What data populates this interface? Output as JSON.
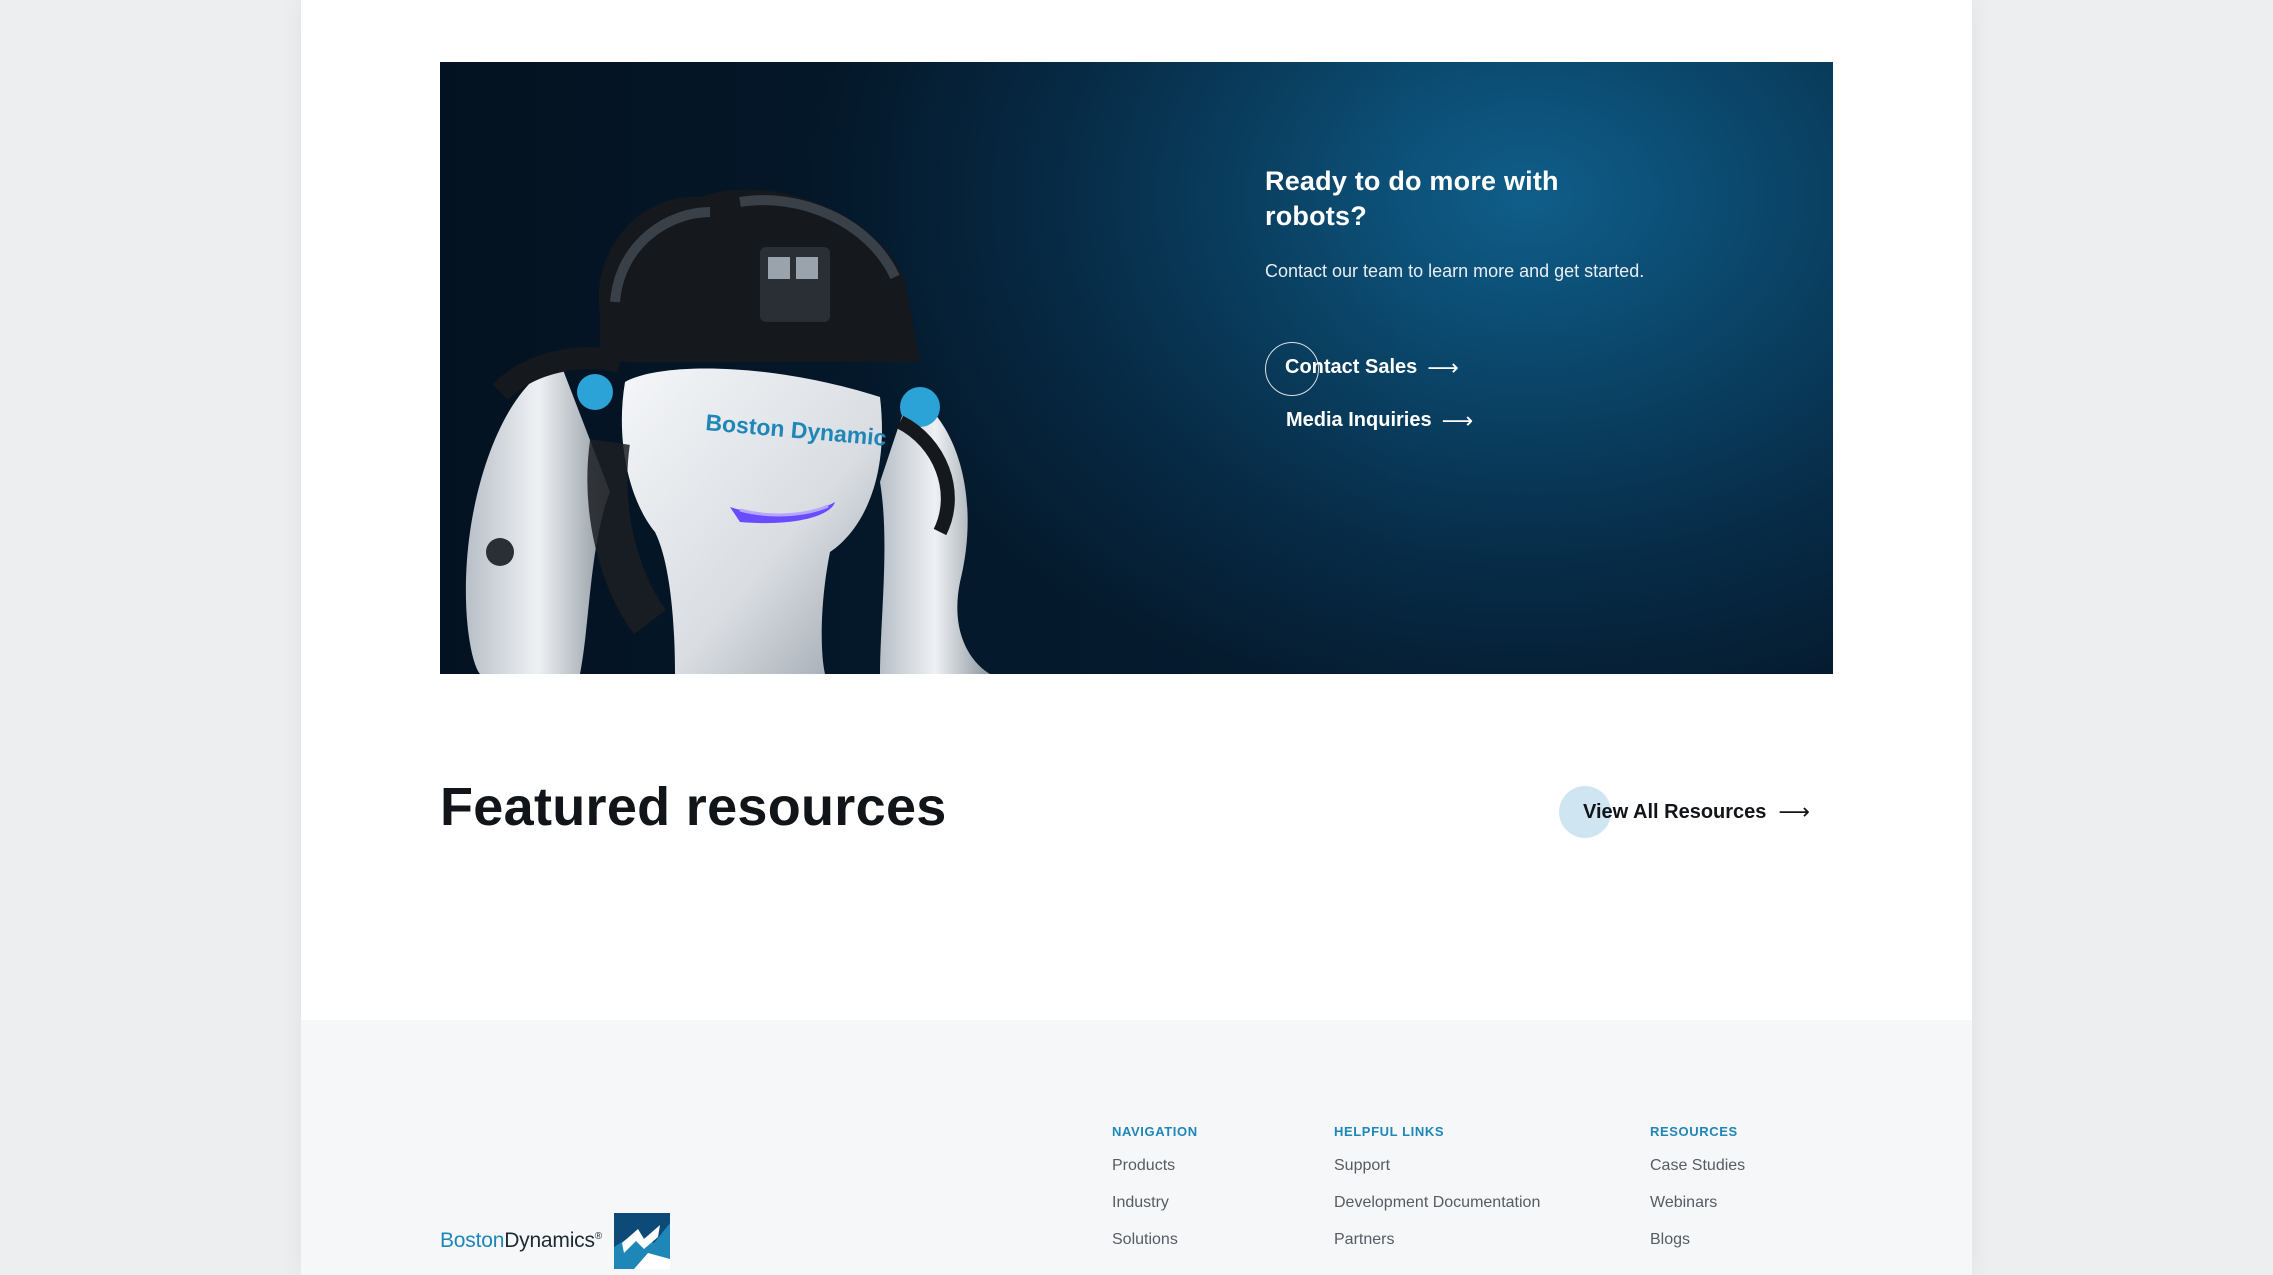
{
  "cta": {
    "heading": "Ready to do more with robots?",
    "subtext": "Contact our team to learn more and get started.",
    "contact_label": "Contact Sales",
    "media_label": "Media Inquiries",
    "arrow": "⟶",
    "robot_chest_label": "Boston Dynamic"
  },
  "featured": {
    "title": "Featured resources",
    "view_all_label": "View All Resources",
    "arrow": "⟶"
  },
  "footer": {
    "logo_part1": "Boston",
    "logo_part2": "Dynamics",
    "logo_mark": "®",
    "columns": [
      {
        "heading": "NAVIGATION",
        "links": [
          "Products",
          "Industry",
          "Solutions"
        ]
      },
      {
        "heading": "HELPFUL LINKS",
        "links": [
          "Support",
          "Development Documentation",
          "Partners"
        ]
      },
      {
        "heading": "RESOURCES",
        "links": [
          "Case Studies",
          "Webinars",
          "Blogs"
        ]
      }
    ]
  },
  "colors": {
    "accent": "#1f86b8",
    "banner": "#0a4366",
    "footer_bg": "#f6f7f9"
  }
}
